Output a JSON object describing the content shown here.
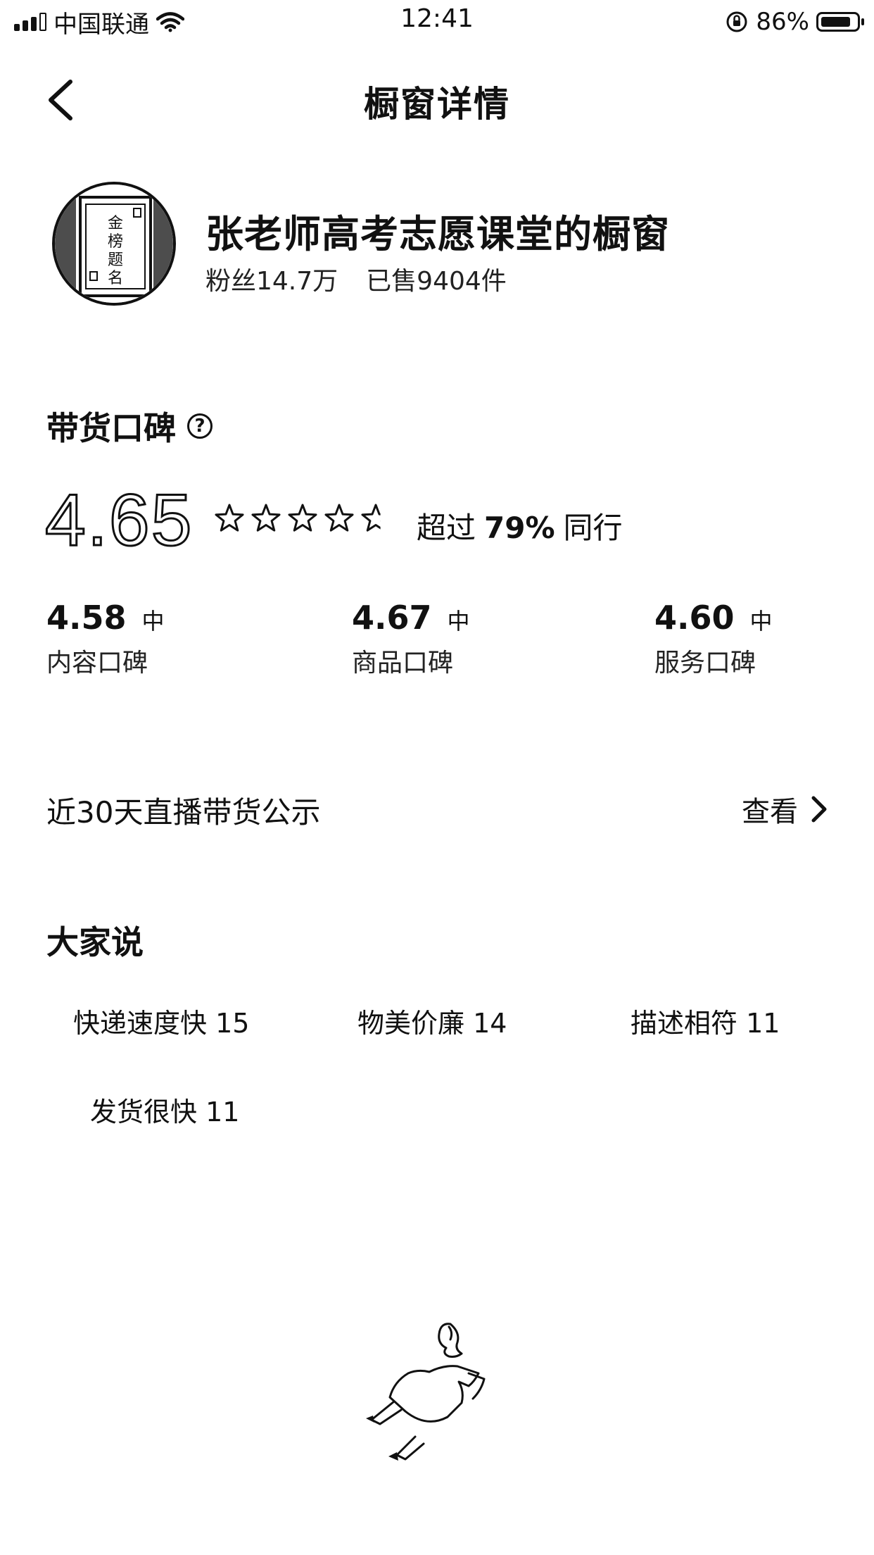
{
  "status_bar": {
    "carrier": "中国联通",
    "time": "12:41",
    "battery_percent": "86%",
    "battery_level": 0.86
  },
  "nav": {
    "title": "橱窗详情",
    "back_icon": "chevron-left-icon"
  },
  "profile": {
    "shop_name": "张老师高考志愿课堂的橱窗",
    "fans": "粉丝14.7万",
    "sold": "已售9404件"
  },
  "reputation": {
    "title": "带货口碑",
    "help_icon": "question-circle-icon",
    "score": "4.65",
    "stars": 4.65,
    "exceed_prefix": "超过",
    "exceed_percent": "79%",
    "exceed_suffix": "同行",
    "sub_scores": [
      {
        "score": "4.58",
        "level": "中",
        "label": "内容口碑"
      },
      {
        "score": "4.67",
        "level": "中",
        "label": "商品口碑"
      },
      {
        "score": "4.60",
        "level": "中",
        "label": "服务口碑"
      }
    ]
  },
  "live_disclosure": {
    "label": "近30天直播带货公示",
    "link": "查看"
  },
  "reviews": {
    "title": "大家说",
    "tags": [
      "快递速度快 15",
      "物美价廉 14",
      "描述相符 11",
      "发货很快 11"
    ]
  }
}
